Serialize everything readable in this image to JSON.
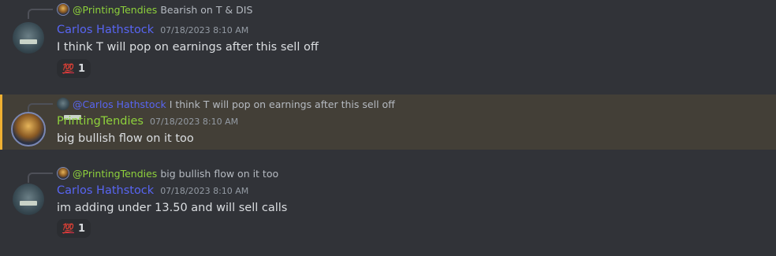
{
  "colors": {
    "carlos": "#5865f2",
    "tendies": "#8ed13c",
    "highlight_bg": "#433f37",
    "highlight_border": "#f0b132"
  },
  "messages": [
    {
      "reply": {
        "author": "@PrintingTendies",
        "text": "Bearish on T & DIS",
        "avatar_icon": "king-avatar-icon"
      },
      "author": "Carlos Hathstock",
      "avatar_icon": "carlos-avatar",
      "timestamp": "07/18/2023 8:10 AM",
      "content": "I think T will pop on earnings after this sell off",
      "reaction": {
        "emoji": "💯",
        "count": "1"
      }
    },
    {
      "reply": {
        "author": "@Carlos Hathstock",
        "text": "I think T will pop on earnings after this sell off",
        "avatar_icon": "carlos-avatar-icon"
      },
      "author": "PrintingTendies",
      "avatar_icon": "king-avatar",
      "timestamp": "07/18/2023 8:10 AM",
      "content": "big bullish flow on it too",
      "highlighted": true
    },
    {
      "reply": {
        "author": "@PrintingTendies",
        "text": "big bullish flow on it too",
        "avatar_icon": "king-avatar-icon"
      },
      "author": "Carlos Hathstock",
      "avatar_icon": "carlos-avatar",
      "timestamp": "07/18/2023 8:10 AM",
      "content": "im adding under 13.50 and will sell calls",
      "reaction": {
        "emoji": "💯",
        "count": "1"
      }
    }
  ]
}
